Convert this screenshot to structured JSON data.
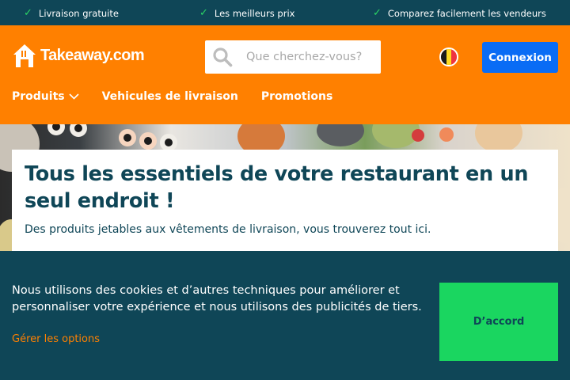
{
  "top_bar": {
    "usps": [
      {
        "icon": "check-icon",
        "text": "Livraison gratuite"
      },
      {
        "icon": "check-icon",
        "text": "Les meilleurs prix"
      },
      {
        "icon": "check-icon",
        "text": "Comparez facilement les vendeurs"
      }
    ]
  },
  "header": {
    "logo_text": "Takeaway.com",
    "logo_icon": "house-icon",
    "search": {
      "placeholder": "Que cherchez-vous?",
      "icon": "search-icon"
    },
    "language_flag": "belgium-flag-icon",
    "login_label": "Connexion"
  },
  "nav": {
    "items": [
      {
        "label": "Produits",
        "has_dropdown": true
      },
      {
        "label": "Vehicules de livraison"
      },
      {
        "label": "Promotions"
      }
    ]
  },
  "hero": {
    "title": "Tous les essentiels de votre restaurant en un seul endroit !",
    "subtitle": "Des produits jetables aux vêtements de livraison, vous trouverez tout ici."
  },
  "cookie_banner": {
    "text": "Nous utilisons des cookies et d’autres techniques pour améliorer et personnaliser votre expérience et nous utilisons des publicités de tiers.",
    "options_link": "Gérer les options",
    "accept_label": "D’accord"
  },
  "colors": {
    "brand_orange": "#ff8000",
    "dark_teal": "#0f4657",
    "button_blue": "#0a6cf5",
    "accept_green": "#1ad660",
    "check_green": "#2bd665"
  }
}
